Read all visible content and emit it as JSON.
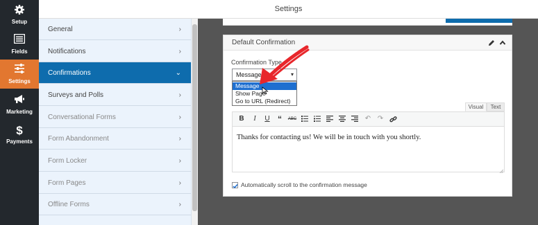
{
  "header": {
    "title": "Settings"
  },
  "rail": {
    "items": [
      {
        "label": "Setup",
        "icon": "gear-icon"
      },
      {
        "label": "Fields",
        "icon": "fields-icon"
      },
      {
        "label": "Settings",
        "icon": "sliders-icon"
      },
      {
        "label": "Marketing",
        "icon": "megaphone-icon"
      },
      {
        "label": "Payments",
        "icon": "dollar-icon"
      }
    ],
    "active": "Settings"
  },
  "settings_nav": {
    "items": [
      {
        "label": "General"
      },
      {
        "label": "Notifications"
      },
      {
        "label": "Confirmations",
        "active": true
      },
      {
        "label": "Surveys and Polls"
      },
      {
        "label": "Conversational Forms"
      },
      {
        "label": "Form Abandonment"
      },
      {
        "label": "Form Locker"
      },
      {
        "label": "Form Pages"
      },
      {
        "label": "Offline Forms"
      }
    ]
  },
  "confirmation": {
    "title": "Default Confirmation",
    "type_label": "Confirmation Type",
    "type_value": "Message",
    "options": [
      "Message",
      "Show Page",
      "Go to URL (Redirect)"
    ],
    "highlighted_option": "Message",
    "editor_tabs": {
      "visual": "Visual",
      "text": "Text"
    },
    "message": "Thanks for contacting us! We will be in touch with you shortly.",
    "autoscroll_label": "Automatically scroll to the confirmation message",
    "autoscroll_checked": true
  },
  "colors": {
    "rail_bg": "#23282d",
    "rail_active": "#e27730",
    "nav_active": "#0e6cad",
    "annotation_arrow": "#e8262b"
  }
}
